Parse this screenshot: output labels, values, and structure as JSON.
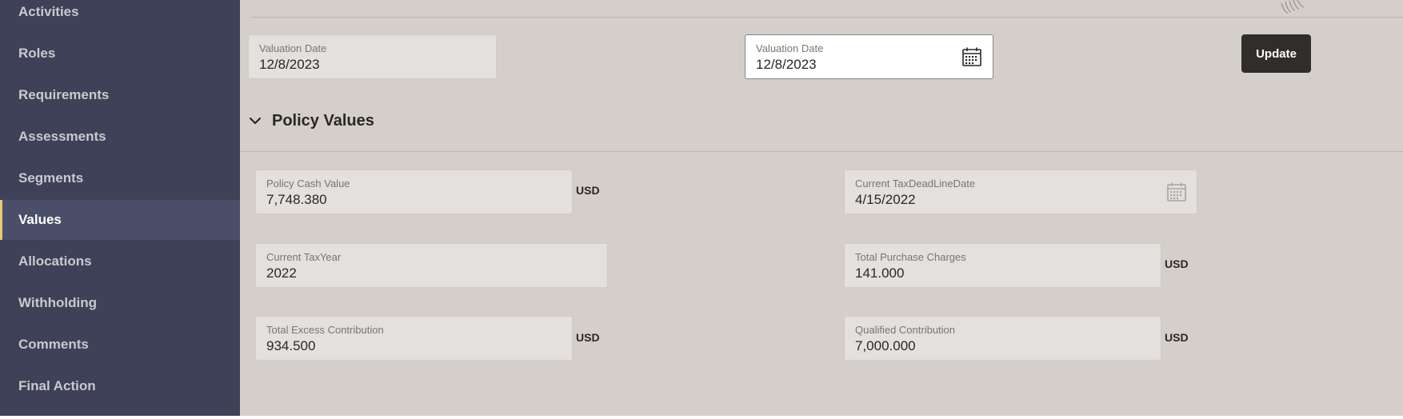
{
  "sidebar": {
    "items": [
      {
        "label": "Activities"
      },
      {
        "label": "Roles"
      },
      {
        "label": "Requirements"
      },
      {
        "label": "Assessments"
      },
      {
        "label": "Segments"
      },
      {
        "label": "Values"
      },
      {
        "label": "Allocations"
      },
      {
        "label": "Withholding"
      },
      {
        "label": "Comments"
      },
      {
        "label": "Final Action"
      }
    ],
    "active_item": "Values"
  },
  "valuation": {
    "current": {
      "label": "Valuation Date",
      "value": "12/8/2023"
    },
    "new": {
      "label": "Valuation Date",
      "value": "12/8/2023"
    },
    "update_label": "Update"
  },
  "policy_values": {
    "title": "Policy Values",
    "fields": {
      "cash_value": {
        "label": "Policy Cash Value",
        "value": "7,748.380",
        "unit": "USD"
      },
      "tax_deadline": {
        "label": "Current TaxDeadLineDate",
        "value": "4/15/2022"
      },
      "tax_year": {
        "label": "Current TaxYear",
        "value": "2022"
      },
      "purchase_charges": {
        "label": "Total Purchase Charges",
        "value": "141.000",
        "unit": "USD"
      },
      "excess_contribution": {
        "label": "Total Excess Contribution",
        "value": "934.500",
        "unit": "USD"
      },
      "qualified_contribution": {
        "label": "Qualified Contribution",
        "value": "7,000.000",
        "unit": "USD"
      }
    }
  },
  "icons": {
    "calendar": "calendar-icon",
    "chevron": "chevron-down-icon"
  },
  "colors": {
    "sidebar_bg": "#3e4157",
    "sidebar_active_bg": "#4a4e68",
    "sidebar_active_accent": "#e8c877",
    "content_bg": "#d4cfca",
    "button_bg": "#312d2a"
  }
}
